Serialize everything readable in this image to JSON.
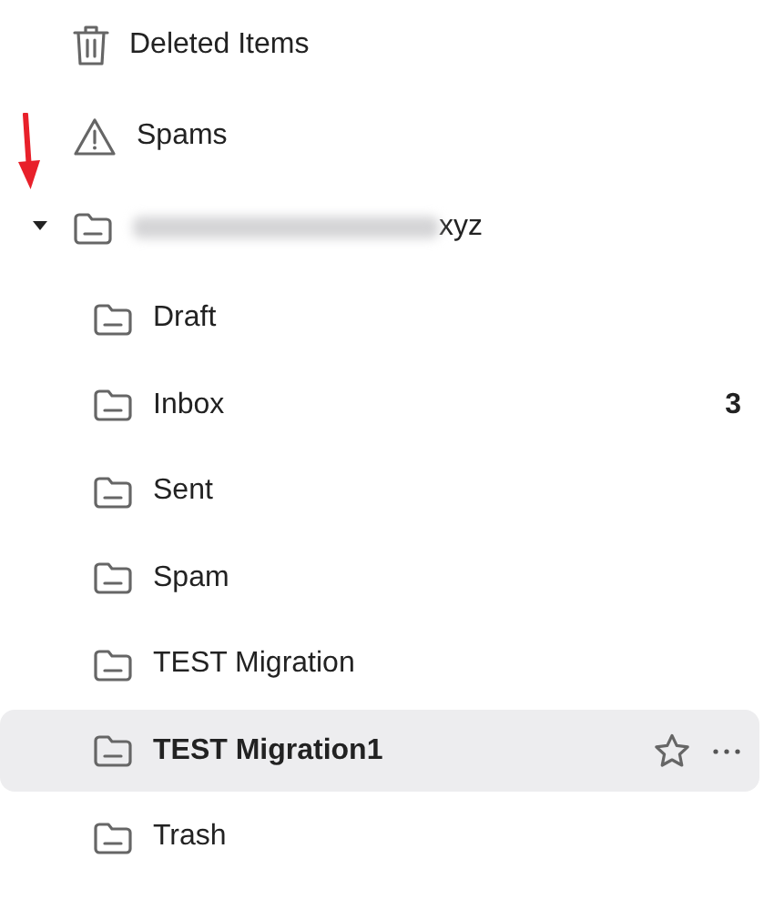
{
  "folders": [
    {
      "kind": "trash",
      "label": "Deleted Items"
    },
    {
      "kind": "warning",
      "label": "Spams"
    }
  ],
  "account": {
    "label": "xyz",
    "expanded": true,
    "children": [
      {
        "label": "Draft",
        "selected": false
      },
      {
        "label": "Inbox",
        "count": "3",
        "selected": false
      },
      {
        "label": "Sent",
        "selected": false
      },
      {
        "label": "Spam",
        "selected": false
      },
      {
        "label": "TEST Migration",
        "selected": false
      },
      {
        "label": "TEST Migration1",
        "selected": true
      },
      {
        "label": "Trash",
        "selected": false
      }
    ]
  }
}
